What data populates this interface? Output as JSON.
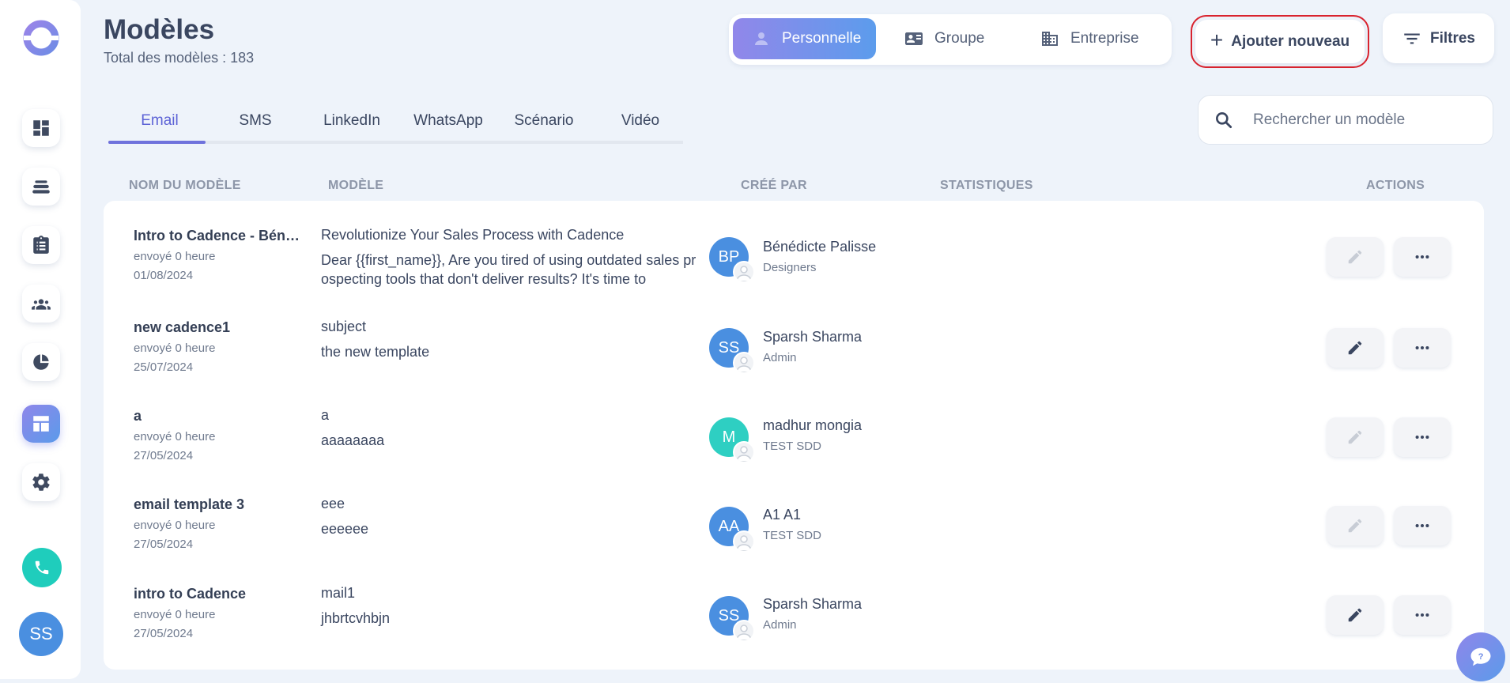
{
  "header": {
    "title": "Modèles",
    "subtitle": "Total des modèles : 183"
  },
  "scope": {
    "items": [
      {
        "label": "Personnelle",
        "icon": "user-icon",
        "active": true
      },
      {
        "label": "Groupe",
        "icon": "id-card-icon",
        "active": false
      },
      {
        "label": "Entreprise",
        "icon": "building-icon",
        "active": false
      }
    ]
  },
  "toolbar": {
    "add_label": "Ajouter nouveau",
    "filter_label": "Filtres"
  },
  "tabs": [
    {
      "label": "Email",
      "active": true
    },
    {
      "label": "SMS",
      "active": false
    },
    {
      "label": "LinkedIn",
      "active": false
    },
    {
      "label": "WhatsApp",
      "active": false
    },
    {
      "label": "Scénario",
      "active": false
    },
    {
      "label": "Vidéo",
      "active": false
    }
  ],
  "search": {
    "placeholder": "Rechercher un modèle"
  },
  "table": {
    "columns": {
      "name": "NOM DU MODÈLE",
      "template": "MODÈLE",
      "created_by": "CRÉÉ PAR",
      "stats": "STATISTIQUES",
      "actions": "ACTIONS"
    },
    "rows": [
      {
        "name": "Intro to Cadence - Bénédicte",
        "sent": "envoyé 0 heure",
        "date": "01/08/2024",
        "subject": "Revolutionize Your Sales Process with Cadence",
        "body": "Dear {{first_name}},   Are you tired of using outdated sales prospecting tools that don't deliver results? It's time to",
        "initials": "BP",
        "creator": "Bénédicte Palisse",
        "team": "Designers",
        "edit_enabled": false
      },
      {
        "name": "new cadence1",
        "sent": "envoyé 0 heure",
        "date": "25/07/2024",
        "subject": "subject",
        "body": "the new template",
        "initials": "SS",
        "creator": "Sparsh Sharma",
        "team": "Admin",
        "edit_enabled": true
      },
      {
        "name": "a",
        "sent": "envoyé 0 heure",
        "date": "27/05/2024",
        "subject": "a",
        "body": "aaaaaaaa",
        "initials": "M",
        "creator": "madhur mongia",
        "team": "TEST SDD",
        "edit_enabled": false
      },
      {
        "name": "email template 3",
        "sent": "envoyé 0 heure",
        "date": "27/05/2024",
        "subject": "eee",
        "body": "eeeeee",
        "initials": "AA",
        "creator": "A1 A1",
        "team": "TEST SDD",
        "edit_enabled": false
      },
      {
        "name": "intro to Cadence",
        "sent": "envoyé 0 heure",
        "date": "27/05/2024",
        "subject": "mail1",
        "body": "jhbrtcvhbjn",
        "initials": "SS",
        "creator": "Sparsh Sharma",
        "team": "Admin",
        "edit_enabled": true
      }
    ]
  },
  "user": {
    "initials": "SS"
  },
  "colors": {
    "accent": "#6f72dc",
    "avatar_blue": "#4a8fe0",
    "avatar_teal": "#2ecfc2",
    "phone": "#1fcdbc",
    "highlight_border": "#d9232e"
  }
}
